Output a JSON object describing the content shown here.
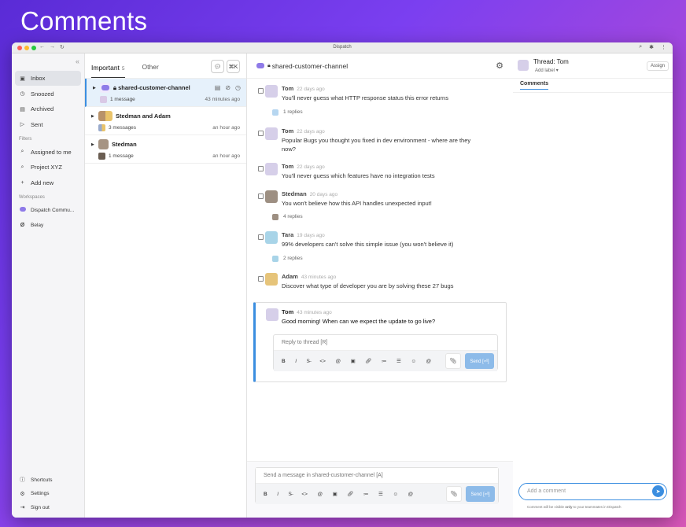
{
  "page_title": "Comments",
  "window": {
    "title": "Dispatch"
  },
  "sidebar": {
    "items": [
      {
        "label": "Inbox",
        "icon": "inbox-icon"
      },
      {
        "label": "Snoozed",
        "icon": "clock-icon"
      },
      {
        "label": "Archived",
        "icon": "archive-icon"
      },
      {
        "label": "Sent",
        "icon": "send-icon"
      }
    ],
    "filters_heading": "Filters",
    "filters": [
      {
        "label": "Assigned to me"
      },
      {
        "label": "Project XYZ"
      },
      {
        "label": "Add new"
      }
    ],
    "workspaces_heading": "Workspaces",
    "workspaces": [
      {
        "label": "Dispatch Commu..."
      },
      {
        "label": "Belay"
      }
    ],
    "bottom": [
      {
        "label": "Shortcuts"
      },
      {
        "label": "Settings"
      },
      {
        "label": "Sign out"
      }
    ]
  },
  "list": {
    "tab_important": "Important",
    "tab_important_count": "5",
    "tab_other": "Other",
    "shortcut": "⌘K",
    "conversations": [
      {
        "name": "shared-customer-channel",
        "sub": "1 message",
        "time": "43 minutes ago"
      },
      {
        "name": "Stedman and Adam",
        "sub": "3 messages",
        "time": "an hour ago"
      },
      {
        "name": "Stedman",
        "sub": "1 message",
        "time": "an hour ago"
      }
    ]
  },
  "main": {
    "channel": "shared-customer-channel",
    "messages": [
      {
        "author": "Tom",
        "ago": "22 days ago",
        "text": "You'll never guess what HTTP response status this error returns",
        "replies": "1 replies"
      },
      {
        "author": "Tom",
        "ago": "22 days ago",
        "text": "Popular Bugs you thought you fixed in dev environment - where are they now?",
        "replies": ""
      },
      {
        "author": "Tom",
        "ago": "22 days ago",
        "text": "You'll never guess which features have no integration tests",
        "replies": ""
      },
      {
        "author": "Stedman",
        "ago": "20 days ago",
        "text": "You won't believe how this API handles unexpected input!",
        "replies": "4 replies"
      },
      {
        "author": "Tara",
        "ago": "19 days ago",
        "text": "99% developers can't solve this simple issue (you won't believe it)",
        "replies": "2 replies"
      },
      {
        "author": "Adam",
        "ago": "43 minutes ago",
        "text": "Discover what type of developer you are by solving these 27 bugs",
        "replies": ""
      }
    ],
    "thread": {
      "author": "Tom",
      "ago": "43 minutes ago",
      "text": "Good morning! When can we expect the update to go live?"
    },
    "reply_placeholder": "Reply to thread [R]",
    "send_label": "Send [⏎]",
    "composer_placeholder": "Send a message in shared-customer-channel [A]"
  },
  "right": {
    "thread_title": "Thread: Tom",
    "add_label": "Add label",
    "assign": "Assign",
    "tab": "Comments",
    "comment_placeholder": "Add a comment",
    "note_prefix": "Comment will be visible ",
    "note_bold": "only",
    "note_suffix": " to your teammates in Dispatch"
  },
  "colors": {
    "accent": "#3b8ee0",
    "send_disabled": "#8dbbe9",
    "selected_row": "#e6f1fb"
  }
}
